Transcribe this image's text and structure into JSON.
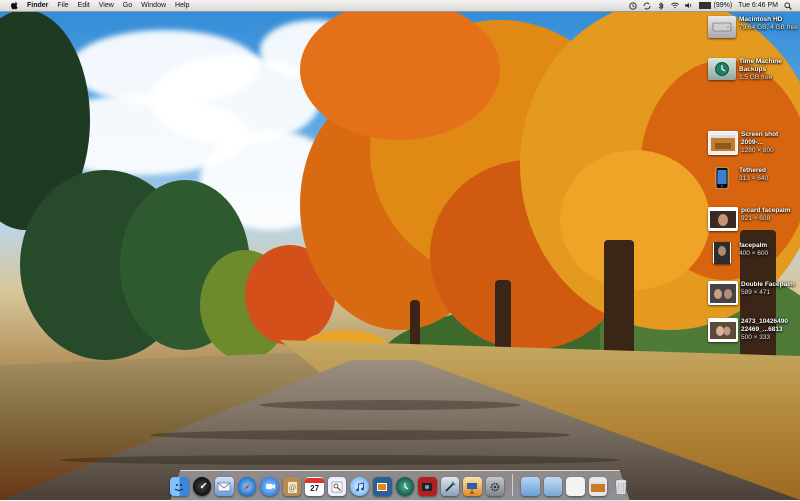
{
  "menubar": {
    "apple_icon": "apple-icon",
    "items": [
      "Finder",
      "File",
      "Edit",
      "View",
      "Go",
      "Window",
      "Help"
    ],
    "battery_percent": "(99%)",
    "battery_level": 0.99,
    "clock": "Tue 6:46 PM"
  },
  "desktop": {
    "icons": [
      {
        "name": "Macintosh HD",
        "sub": "79.64 GB, 4 GB free",
        "icon": "hard-drive-icon"
      },
      {
        "name": "Time Machine Backups",
        "sub": "1.5 GB free",
        "icon": "time-machine-icon"
      },
      {
        "name": "Screen shot 2009-...",
        "sub": "1280 × 800",
        "icon": "screenshot-icon"
      },
      {
        "name": "Tethered",
        "sub": "313 × 640",
        "icon": "phone-icon"
      },
      {
        "name": "picard facepalm",
        "sub": "921 × 608",
        "icon": "image-icon"
      },
      {
        "name": "facepalm",
        "sub": "400 × 600",
        "icon": "image-icon"
      },
      {
        "name": "Double Facepalm",
        "sub": "589 × 471",
        "icon": "image-icon"
      },
      {
        "name": "2473_10426490 22469_...6813",
        "sub": "500 × 333",
        "icon": "image-icon"
      }
    ]
  },
  "dock": {
    "items": [
      {
        "name": "Finder",
        "icon": "finder-icon"
      },
      {
        "name": "Dashboard",
        "icon": "dashboard-icon"
      },
      {
        "name": "Mail",
        "icon": "mail-icon"
      },
      {
        "name": "Safari",
        "icon": "safari-icon"
      },
      {
        "name": "iChat",
        "icon": "ichat-icon"
      },
      {
        "name": "Address Book",
        "icon": "address-book-icon"
      },
      {
        "name": "iCal",
        "icon": "ical-icon",
        "badge": "27"
      },
      {
        "name": "Preview",
        "icon": "preview-icon"
      },
      {
        "name": "iTunes",
        "icon": "itunes-icon"
      },
      {
        "name": "iPhoto",
        "icon": "iphoto-icon"
      },
      {
        "name": "Time Machine",
        "icon": "time-machine-icon"
      },
      {
        "name": "Photo Booth",
        "icon": "photo-booth-icon"
      },
      {
        "name": "Xcode",
        "icon": "xcode-icon"
      },
      {
        "name": "Keynote",
        "icon": "keynote-icon"
      },
      {
        "name": "System Preferences",
        "icon": "system-preferences-icon"
      }
    ],
    "right_items": [
      {
        "name": "Applications",
        "icon": "applications-folder-icon"
      },
      {
        "name": "Documents",
        "icon": "documents-folder-icon"
      },
      {
        "name": "Downloads",
        "icon": "downloads-stack-icon"
      },
      {
        "name": "Screenshot",
        "icon": "screenshot-stack-icon"
      },
      {
        "name": "Trash",
        "icon": "trash-icon"
      }
    ]
  }
}
